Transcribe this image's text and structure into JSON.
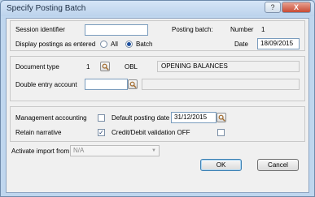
{
  "window": {
    "title": "Specify Posting Batch",
    "help_label": "?",
    "close_label": "X"
  },
  "session": {
    "identifier_label": "Session identifier",
    "identifier_value": "",
    "display_label": "Display postings as entered",
    "all_label": "All",
    "batch_label": "Batch",
    "selected_option": "Batch",
    "posting_batch_label": "Posting batch:",
    "number_label": "Number",
    "number_value": "1",
    "date_label": "Date",
    "date_value": "18/09/2015"
  },
  "document": {
    "type_label": "Document type",
    "type_value": "1",
    "type_code": "OBL",
    "type_description": "OPENING BALANCES",
    "double_entry_label": "Double entry account",
    "double_entry_value": "",
    "double_entry_description": ""
  },
  "options": {
    "management_label": "Management accounting",
    "management_checked": false,
    "default_date_label": "Default posting date",
    "default_date_value": "31/12/2015",
    "retain_label": "Retain narrative",
    "retain_checked": true,
    "validation_label": "Credit/Debit validation OFF",
    "validation_checked": false
  },
  "import": {
    "label": "Activate import from",
    "value": "N/A"
  },
  "buttons": {
    "ok": "OK",
    "cancel": "Cancel"
  }
}
